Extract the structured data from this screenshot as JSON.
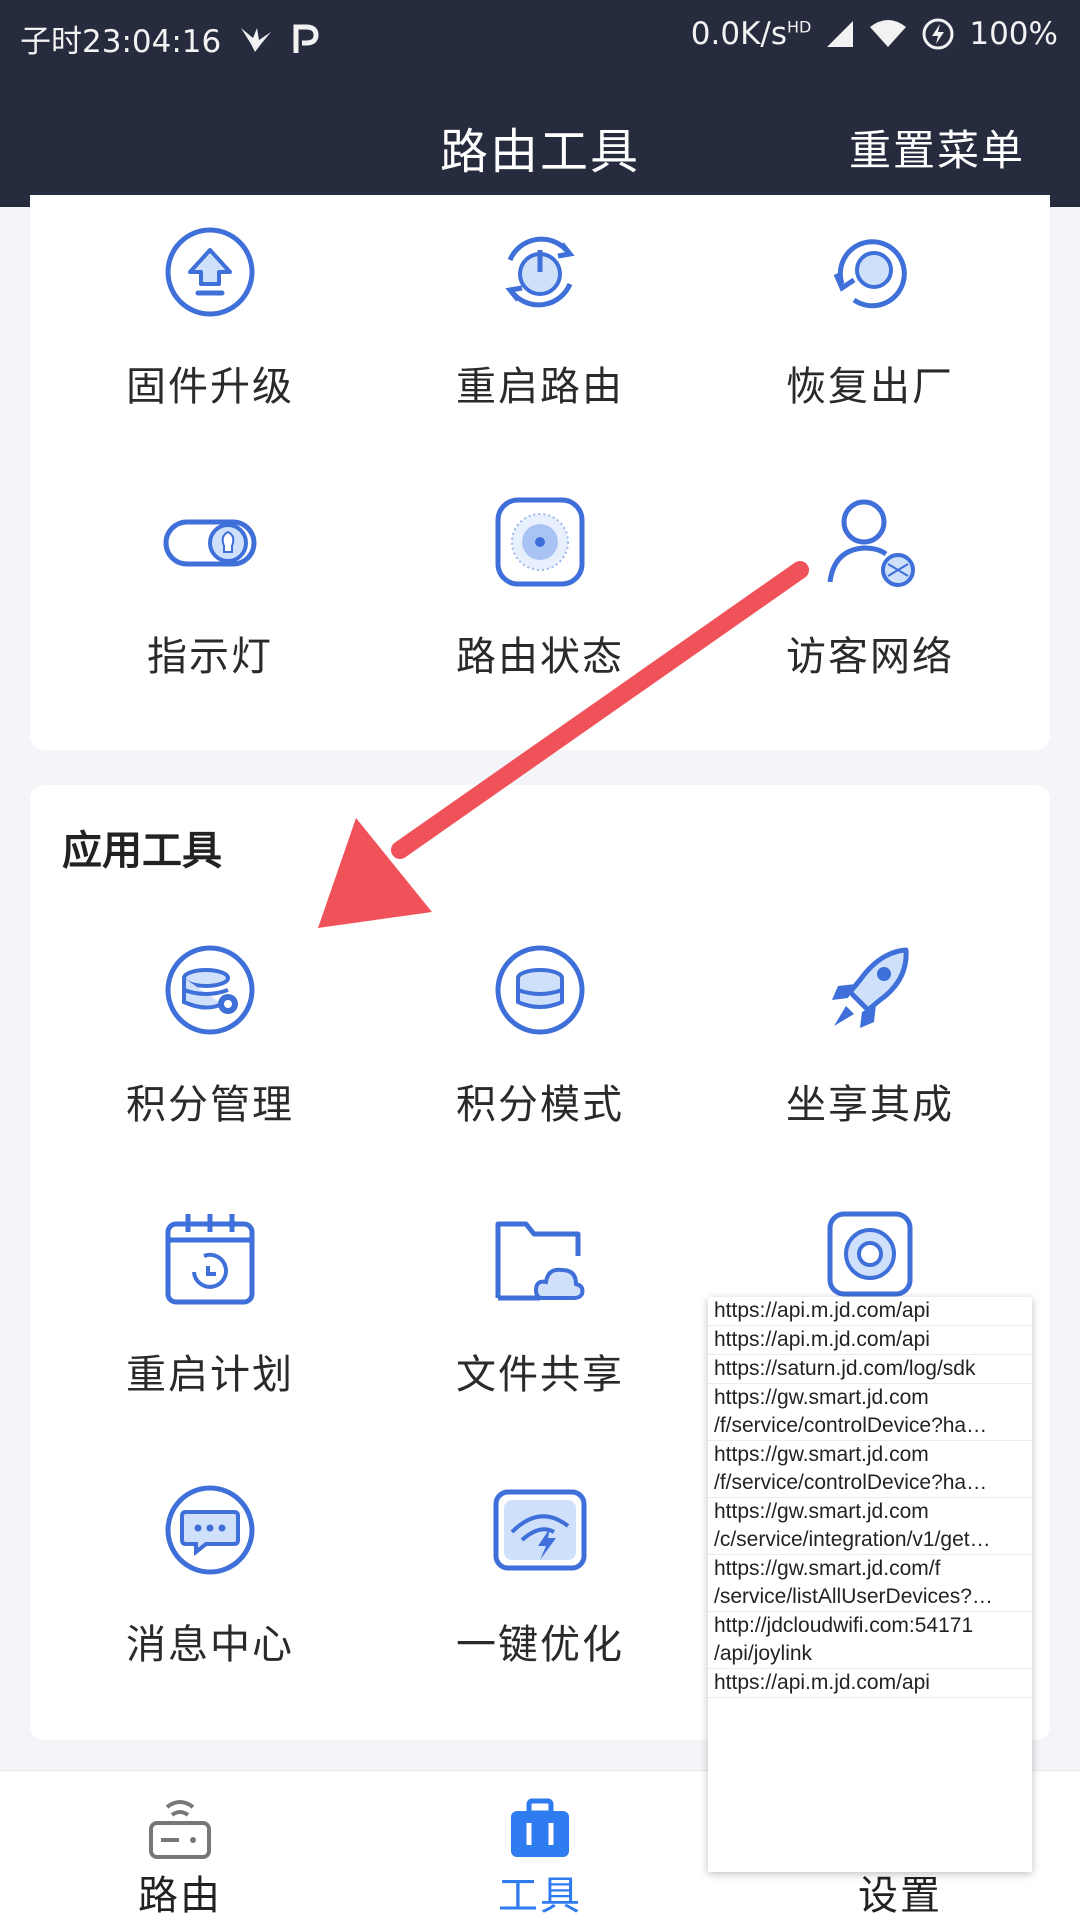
{
  "status_bar": {
    "time": "子时23:04:16",
    "network_speed": "0.0K/s",
    "network_type": "HD",
    "battery": "100%"
  },
  "header": {
    "title": "路由工具",
    "right_action": "重置菜单"
  },
  "router_tools": [
    {
      "label": "固件升级",
      "icon": "upload-icon"
    },
    {
      "label": "重启路由",
      "icon": "restart-icon"
    },
    {
      "label": "恢复出厂",
      "icon": "reset-icon"
    },
    {
      "label": "指示灯",
      "icon": "toggle-light-icon"
    },
    {
      "label": "路由状态",
      "icon": "router-status-icon"
    },
    {
      "label": "访客网络",
      "icon": "guest-network-icon"
    }
  ],
  "app_tools": {
    "title": "应用工具",
    "items": [
      {
        "label": "积分管理",
        "icon": "points-manage-icon"
      },
      {
        "label": "积分模式",
        "icon": "points-mode-icon"
      },
      {
        "label": "坐享其成",
        "icon": "rocket-icon"
      },
      {
        "label": "重启计划",
        "icon": "calendar-icon"
      },
      {
        "label": "文件共享",
        "icon": "folder-cloud-icon"
      },
      {
        "label": "",
        "icon": "device-icon"
      },
      {
        "label": "消息中心",
        "icon": "message-icon"
      },
      {
        "label": "一键优化",
        "icon": "optimize-icon"
      }
    ]
  },
  "request_log": [
    [
      "https://api.m.jd.com/api"
    ],
    [
      "https://api.m.jd.com/api"
    ],
    [
      "https://saturn.jd.com/log/sdk"
    ],
    [
      "https://gw.smart.jd.com",
      "/f/service/controlDevice?ha…"
    ],
    [
      "https://gw.smart.jd.com",
      "/f/service/controlDevice?ha…"
    ],
    [
      "https://gw.smart.jd.com",
      "/c/service/integration/v1/get…"
    ],
    [
      "https://gw.smart.jd.com/f",
      "/service/listAllUserDevices?…"
    ],
    [
      "http://jdcloudwifi.com:54171",
      "/api/joylink"
    ],
    [
      "https://api.m.jd.com/api"
    ]
  ],
  "bottom_nav": {
    "tabs": [
      {
        "label": "路由",
        "icon": "router-icon",
        "active": false
      },
      {
        "label": "工具",
        "icon": "toolbox-icon",
        "active": true
      },
      {
        "label": "设置",
        "icon": "settings-icon",
        "active": false
      }
    ]
  },
  "colors": {
    "header_bg": "#262b3e",
    "accent": "#3f6fd8",
    "active_tab": "#2f7bf0",
    "annotation_arrow": "#f0525a"
  }
}
